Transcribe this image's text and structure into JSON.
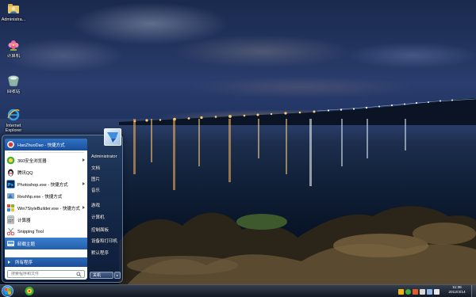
{
  "desktop": {
    "icons": [
      {
        "name": "administrator-folder-icon",
        "label": "Administra..."
      },
      {
        "name": "computer-icon",
        "label": "计算机"
      },
      {
        "name": "recycle-bin-icon",
        "label": "回收站"
      },
      {
        "name": "ie-icon",
        "label": "Internet Explorer"
      }
    ]
  },
  "start_menu": {
    "programs": [
      {
        "label": "HaoZhuoDao - 快捷方式",
        "icon": "globe-icon",
        "has_arrow": false,
        "state": "highlight"
      },
      {
        "label": "360安全浏览器",
        "icon": "360-browser-icon",
        "has_arrow": true,
        "state": ""
      },
      {
        "label": "腾讯QQ",
        "icon": "qq-penguin-icon",
        "has_arrow": false,
        "state": ""
      },
      {
        "label": "Photoshop.exe - 快捷方式",
        "icon": "photoshop-icon",
        "has_arrow": true,
        "state": ""
      },
      {
        "label": "Reshhp.exe - 快捷方式",
        "icon": "reshacker-icon",
        "has_arrow": false,
        "state": ""
      },
      {
        "label": "Win7StyleBuilder.exe - 快捷方式",
        "icon": "stylebuilder-icon",
        "has_arrow": true,
        "state": ""
      },
      {
        "label": "计算器",
        "icon": "calculator-icon",
        "has_arrow": false,
        "state": ""
      },
      {
        "label": "Snipping Tool",
        "icon": "scissors-icon",
        "has_arrow": false,
        "state": ""
      },
      {
        "label": "卸载主题",
        "icon": "uninstall-icon",
        "has_arrow": false,
        "state": "hover"
      }
    ],
    "all_programs": "所有程序",
    "search_placeholder": "搜索程序和文件",
    "right_items": [
      "Administrator",
      "文档",
      "图片",
      "音乐",
      "游戏",
      "计算机",
      "控制面板",
      "设备和打印机",
      "默认程序"
    ],
    "shutdown": "关机"
  },
  "taskbar": {
    "apps": [
      "360-browser-icon"
    ],
    "tray_icons": [
      "qq-tray-icon",
      "360-tray-icon",
      "update-tray-icon",
      "flag-tray-icon",
      "network-tray-icon",
      "volume-tray-icon"
    ],
    "clock_time": "11:36",
    "clock_date": "2012/4/14"
  },
  "colors": {
    "start_highlight": "#2f72c4",
    "start_orb": "#1f78c9",
    "taskbar": "#1a202a"
  }
}
